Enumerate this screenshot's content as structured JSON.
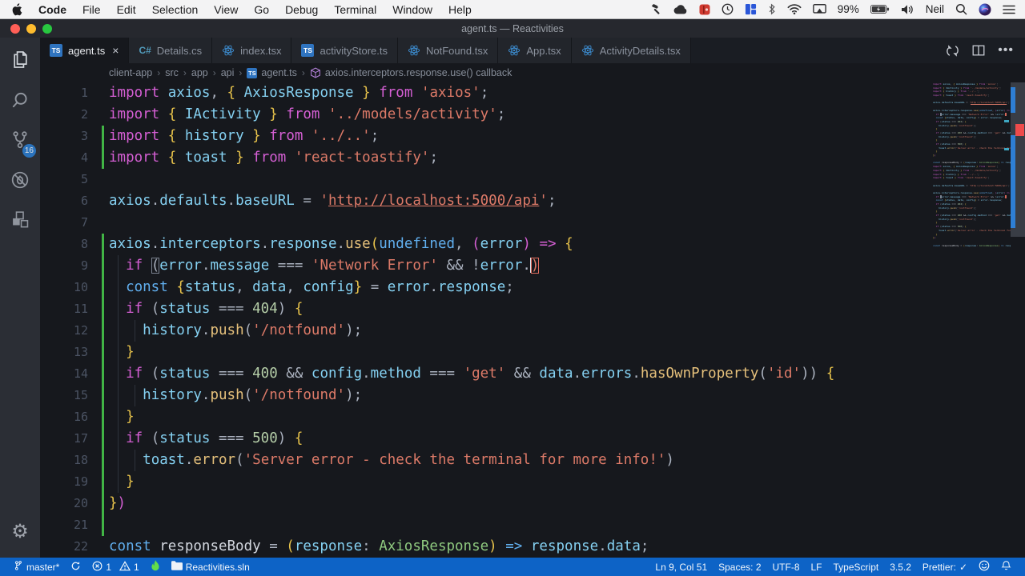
{
  "menu_bar": {
    "app_menu": "Code",
    "items": [
      "File",
      "Edit",
      "Selection",
      "View",
      "Go",
      "Debug",
      "Terminal",
      "Window",
      "Help"
    ],
    "right_icons": [
      "hammer",
      "cloud",
      "keyframe",
      "clock",
      "tiles",
      "bluetooth",
      "wifi",
      "display"
    ],
    "battery_percent": "99%",
    "user": "Neil",
    "right_icons_after": [
      "volume",
      "search",
      "siri",
      "list"
    ]
  },
  "title_bar": {
    "title": "agent.ts — Reactivities"
  },
  "tab_bar": {
    "tabs": [
      {
        "label": "agent.ts",
        "icon": "ts",
        "active": true,
        "close": "×"
      },
      {
        "label": "Details.cs",
        "icon": "cs",
        "active": false
      },
      {
        "label": "index.tsx",
        "icon": "react",
        "active": false
      },
      {
        "label": "activityStore.ts",
        "icon": "ts",
        "active": false
      },
      {
        "label": "NotFound.tsx",
        "icon": "react",
        "active": false
      },
      {
        "label": "App.tsx",
        "icon": "react",
        "active": false
      },
      {
        "label": "ActivityDetails.tsx",
        "icon": "react",
        "active": false
      }
    ],
    "actions": [
      "open-changes",
      "split-editor",
      "more-actions"
    ]
  },
  "breadcrumbs": {
    "segments": [
      "client-app",
      "src",
      "app",
      "api"
    ],
    "file": "agent.ts",
    "symbol": "axios.interceptors.response.use() callback",
    "separator": "›"
  },
  "activity_bar": {
    "top": [
      {
        "name": "explorer"
      },
      {
        "name": "search"
      },
      {
        "name": "source-control",
        "badge": "16"
      },
      {
        "name": "debug"
      },
      {
        "name": "extensions"
      }
    ],
    "bottom": [
      {
        "name": "settings",
        "glyph": "⚙"
      }
    ]
  },
  "editor": {
    "lines": [
      {
        "n": "1",
        "mod": false,
        "guides": [],
        "tokens": [
          [
            "kw",
            "import"
          ],
          [
            "pun",
            " "
          ],
          [
            "id",
            "axios"
          ],
          [
            "pun",
            ", "
          ],
          [
            "brY",
            "{"
          ],
          [
            "pun",
            " "
          ],
          [
            "id",
            "AxiosResponse"
          ],
          [
            "pun",
            " "
          ],
          [
            "brY",
            "}"
          ],
          [
            "pun",
            " "
          ],
          [
            "kw",
            "from"
          ],
          [
            "pun",
            " "
          ],
          [
            "str",
            "'axios'"
          ],
          [
            "pun",
            ";"
          ]
        ]
      },
      {
        "n": "2",
        "mod": false,
        "guides": [],
        "tokens": [
          [
            "kw",
            "import"
          ],
          [
            "pun",
            " "
          ],
          [
            "brY",
            "{"
          ],
          [
            "pun",
            " "
          ],
          [
            "id",
            "IActivity"
          ],
          [
            "pun",
            " "
          ],
          [
            "brY",
            "}"
          ],
          [
            "pun",
            " "
          ],
          [
            "kw",
            "from"
          ],
          [
            "pun",
            " "
          ],
          [
            "str",
            "'../models/activity'"
          ],
          [
            "pun",
            ";"
          ]
        ]
      },
      {
        "n": "3",
        "mod": true,
        "guides": [],
        "tokens": [
          [
            "kw",
            "import"
          ],
          [
            "pun",
            " "
          ],
          [
            "brY",
            "{"
          ],
          [
            "pun",
            " "
          ],
          [
            "id",
            "history"
          ],
          [
            "pun",
            " "
          ],
          [
            "brY",
            "}"
          ],
          [
            "pun",
            " "
          ],
          [
            "kw",
            "from"
          ],
          [
            "pun",
            " "
          ],
          [
            "str",
            "'../..'"
          ],
          [
            "pun",
            ";"
          ]
        ]
      },
      {
        "n": "4",
        "mod": true,
        "guides": [],
        "tokens": [
          [
            "kw",
            "import"
          ],
          [
            "pun",
            " "
          ],
          [
            "brY",
            "{"
          ],
          [
            "pun",
            " "
          ],
          [
            "id",
            "toast"
          ],
          [
            "pun",
            " "
          ],
          [
            "brY",
            "}"
          ],
          [
            "pun",
            " "
          ],
          [
            "kw",
            "from"
          ],
          [
            "pun",
            " "
          ],
          [
            "str",
            "'react-toastify'"
          ],
          [
            "pun",
            ";"
          ]
        ]
      },
      {
        "n": "5",
        "mod": false,
        "guides": [],
        "tokens": []
      },
      {
        "n": "6",
        "mod": false,
        "guides": [],
        "tokens": [
          [
            "id",
            "axios"
          ],
          [
            "pun",
            "."
          ],
          [
            "id",
            "defaults"
          ],
          [
            "pun",
            "."
          ],
          [
            "id",
            "baseURL"
          ],
          [
            "pun",
            " = "
          ],
          [
            "str",
            "'"
          ],
          [
            "strlink",
            "http://localhost:5000/api"
          ],
          [
            "str",
            "'"
          ],
          [
            "pun",
            ";"
          ]
        ]
      },
      {
        "n": "7",
        "mod": false,
        "guides": [],
        "tokens": []
      },
      {
        "n": "8",
        "mod": true,
        "guides": [],
        "tokens": [
          [
            "id",
            "axios"
          ],
          [
            "pun",
            "."
          ],
          [
            "id",
            "interceptors"
          ],
          [
            "pun",
            "."
          ],
          [
            "id",
            "response"
          ],
          [
            "pun",
            "."
          ],
          [
            "fn",
            "use"
          ],
          [
            "brY",
            "("
          ],
          [
            "kw2",
            "undefined"
          ],
          [
            "pun",
            ", "
          ],
          [
            "brP",
            "("
          ],
          [
            "id",
            "error"
          ],
          [
            "brP",
            ")"
          ],
          [
            "pun",
            " "
          ],
          [
            "kw",
            "=>"
          ],
          [
            "pun",
            " "
          ],
          [
            "brY",
            "{"
          ]
        ]
      },
      {
        "n": "9",
        "mod": true,
        "guides": [
          1
        ],
        "tokens": [
          [
            "pun",
            "  "
          ],
          [
            "kw",
            "if"
          ],
          [
            "pun",
            " "
          ],
          [
            "box1",
            "("
          ],
          [
            "id",
            "error"
          ],
          [
            "pun",
            "."
          ],
          [
            "id",
            "message"
          ],
          [
            "pun",
            " === "
          ],
          [
            "str",
            "'Network Error'"
          ],
          [
            "pun",
            " && !"
          ],
          [
            "id",
            "error"
          ],
          [
            "pun",
            "."
          ],
          [
            "cursor",
            ""
          ],
          [
            "box2",
            ")"
          ]
        ]
      },
      {
        "n": "10",
        "mod": true,
        "guides": [
          1
        ],
        "tokens": [
          [
            "pun",
            "  "
          ],
          [
            "kw2",
            "const"
          ],
          [
            "pun",
            " "
          ],
          [
            "brY",
            "{"
          ],
          [
            "id",
            "status"
          ],
          [
            "pun",
            ", "
          ],
          [
            "id",
            "data"
          ],
          [
            "pun",
            ", "
          ],
          [
            "id",
            "config"
          ],
          [
            "brY",
            "}"
          ],
          [
            "pun",
            " = "
          ],
          [
            "id",
            "error"
          ],
          [
            "pun",
            "."
          ],
          [
            "id",
            "response"
          ],
          [
            "pun",
            ";"
          ]
        ]
      },
      {
        "n": "11",
        "mod": true,
        "guides": [
          1
        ],
        "tokens": [
          [
            "pun",
            "  "
          ],
          [
            "kw",
            "if"
          ],
          [
            "pun",
            " ("
          ],
          [
            "id",
            "status"
          ],
          [
            "pun",
            " === "
          ],
          [
            "num",
            "404"
          ],
          [
            "pun",
            ") "
          ],
          [
            "brY",
            "{"
          ]
        ]
      },
      {
        "n": "12",
        "mod": true,
        "guides": [
          1,
          3
        ],
        "tokens": [
          [
            "pun",
            "    "
          ],
          [
            "id",
            "history"
          ],
          [
            "pun",
            "."
          ],
          [
            "fn",
            "push"
          ],
          [
            "pun",
            "("
          ],
          [
            "str",
            "'/notfound'"
          ],
          [
            "pun",
            ");"
          ]
        ]
      },
      {
        "n": "13",
        "mod": true,
        "guides": [
          1
        ],
        "tokens": [
          [
            "pun",
            "  "
          ],
          [
            "brY",
            "}"
          ]
        ]
      },
      {
        "n": "14",
        "mod": true,
        "guides": [
          1
        ],
        "tokens": [
          [
            "pun",
            "  "
          ],
          [
            "kw",
            "if"
          ],
          [
            "pun",
            " ("
          ],
          [
            "id",
            "status"
          ],
          [
            "pun",
            " === "
          ],
          [
            "num",
            "400"
          ],
          [
            "pun",
            " && "
          ],
          [
            "id",
            "config"
          ],
          [
            "pun",
            "."
          ],
          [
            "id",
            "method"
          ],
          [
            "pun",
            " === "
          ],
          [
            "str",
            "'get'"
          ],
          [
            "pun",
            " && "
          ],
          [
            "id",
            "data"
          ],
          [
            "pun",
            "."
          ],
          [
            "id",
            "errors"
          ],
          [
            "pun",
            "."
          ],
          [
            "fn",
            "hasOwnProperty"
          ],
          [
            "pun",
            "("
          ],
          [
            "str",
            "'id'"
          ],
          [
            "pun",
            ")) "
          ],
          [
            "brY",
            "{"
          ]
        ]
      },
      {
        "n": "15",
        "mod": true,
        "guides": [
          1,
          3
        ],
        "tokens": [
          [
            "pun",
            "    "
          ],
          [
            "id",
            "history"
          ],
          [
            "pun",
            "."
          ],
          [
            "fn",
            "push"
          ],
          [
            "pun",
            "("
          ],
          [
            "str",
            "'/notfound'"
          ],
          [
            "pun",
            ");"
          ]
        ]
      },
      {
        "n": "16",
        "mod": true,
        "guides": [
          1
        ],
        "tokens": [
          [
            "pun",
            "  "
          ],
          [
            "brY",
            "}"
          ]
        ]
      },
      {
        "n": "17",
        "mod": true,
        "guides": [
          1
        ],
        "tokens": [
          [
            "pun",
            "  "
          ],
          [
            "kw",
            "if"
          ],
          [
            "pun",
            " ("
          ],
          [
            "id",
            "status"
          ],
          [
            "pun",
            " === "
          ],
          [
            "num",
            "500"
          ],
          [
            "pun",
            ") "
          ],
          [
            "brY",
            "{"
          ]
        ]
      },
      {
        "n": "18",
        "mod": true,
        "guides": [
          1,
          3
        ],
        "tokens": [
          [
            "pun",
            "    "
          ],
          [
            "id",
            "toast"
          ],
          [
            "pun",
            "."
          ],
          [
            "fn",
            "error"
          ],
          [
            "pun",
            "("
          ],
          [
            "str",
            "'Server error - check the terminal for more info!'"
          ],
          [
            "pun",
            ")"
          ]
        ]
      },
      {
        "n": "19",
        "mod": true,
        "guides": [
          1
        ],
        "tokens": [
          [
            "pun",
            "  "
          ],
          [
            "brY",
            "}"
          ]
        ]
      },
      {
        "n": "20",
        "mod": true,
        "guides": [],
        "tokens": [
          [
            "brY",
            "}"
          ],
          [
            "brP",
            ")"
          ]
        ]
      },
      {
        "n": "21",
        "mod": true,
        "guides": [],
        "tokens": []
      },
      {
        "n": "22",
        "mod": false,
        "guides": [],
        "tokens": [
          [
            "kw2",
            "const"
          ],
          [
            "pun",
            " "
          ],
          [
            "idw",
            "responseBody"
          ],
          [
            "pun",
            " = "
          ],
          [
            "brY",
            "("
          ],
          [
            "id",
            "response"
          ],
          [
            "pun",
            ": "
          ],
          [
            "type",
            "AxiosResponse"
          ],
          [
            "brY",
            ")"
          ],
          [
            "pun",
            " "
          ],
          [
            "kw2",
            "=>"
          ],
          [
            "pun",
            " "
          ],
          [
            "id",
            "response"
          ],
          [
            "pun",
            "."
          ],
          [
            "id",
            "data"
          ],
          [
            "pun",
            ";"
          ]
        ]
      }
    ]
  },
  "overview_ruler": {
    "thumb": [
      0,
      193
    ],
    "modified_marks": [
      [
        6,
        38
      ],
      [
        66,
        182
      ]
    ],
    "error_mark": [
      52,
      67
    ],
    "find_ticks": [
      47,
      82
    ]
  },
  "status_bar": {
    "branch": "master*",
    "errors": "1",
    "warnings": "1",
    "solution": "Reactivities.sln",
    "cursor_position": "Ln 9, Col 51",
    "indentation": "Spaces: 2",
    "encoding": "UTF-8",
    "eol": "LF",
    "language": "TypeScript",
    "ts_version": "3.5.2",
    "formatter": "Prettier:",
    "formatter_check": "✓"
  },
  "colors": {
    "status_bar": "#0d63c6",
    "editor_bg": "#16181d",
    "keyword_pink": "#d55fd4",
    "keyword_blue": "#61afef",
    "identifier": "#85d1f2",
    "string": "#dd7a68",
    "number": "#b5cea8",
    "function": "#e5c07b",
    "brace": "#e8c34b",
    "modified_gutter": "#41b445",
    "error_mark": "#ef4b4b",
    "scm_badge": "#2a7fd4"
  }
}
